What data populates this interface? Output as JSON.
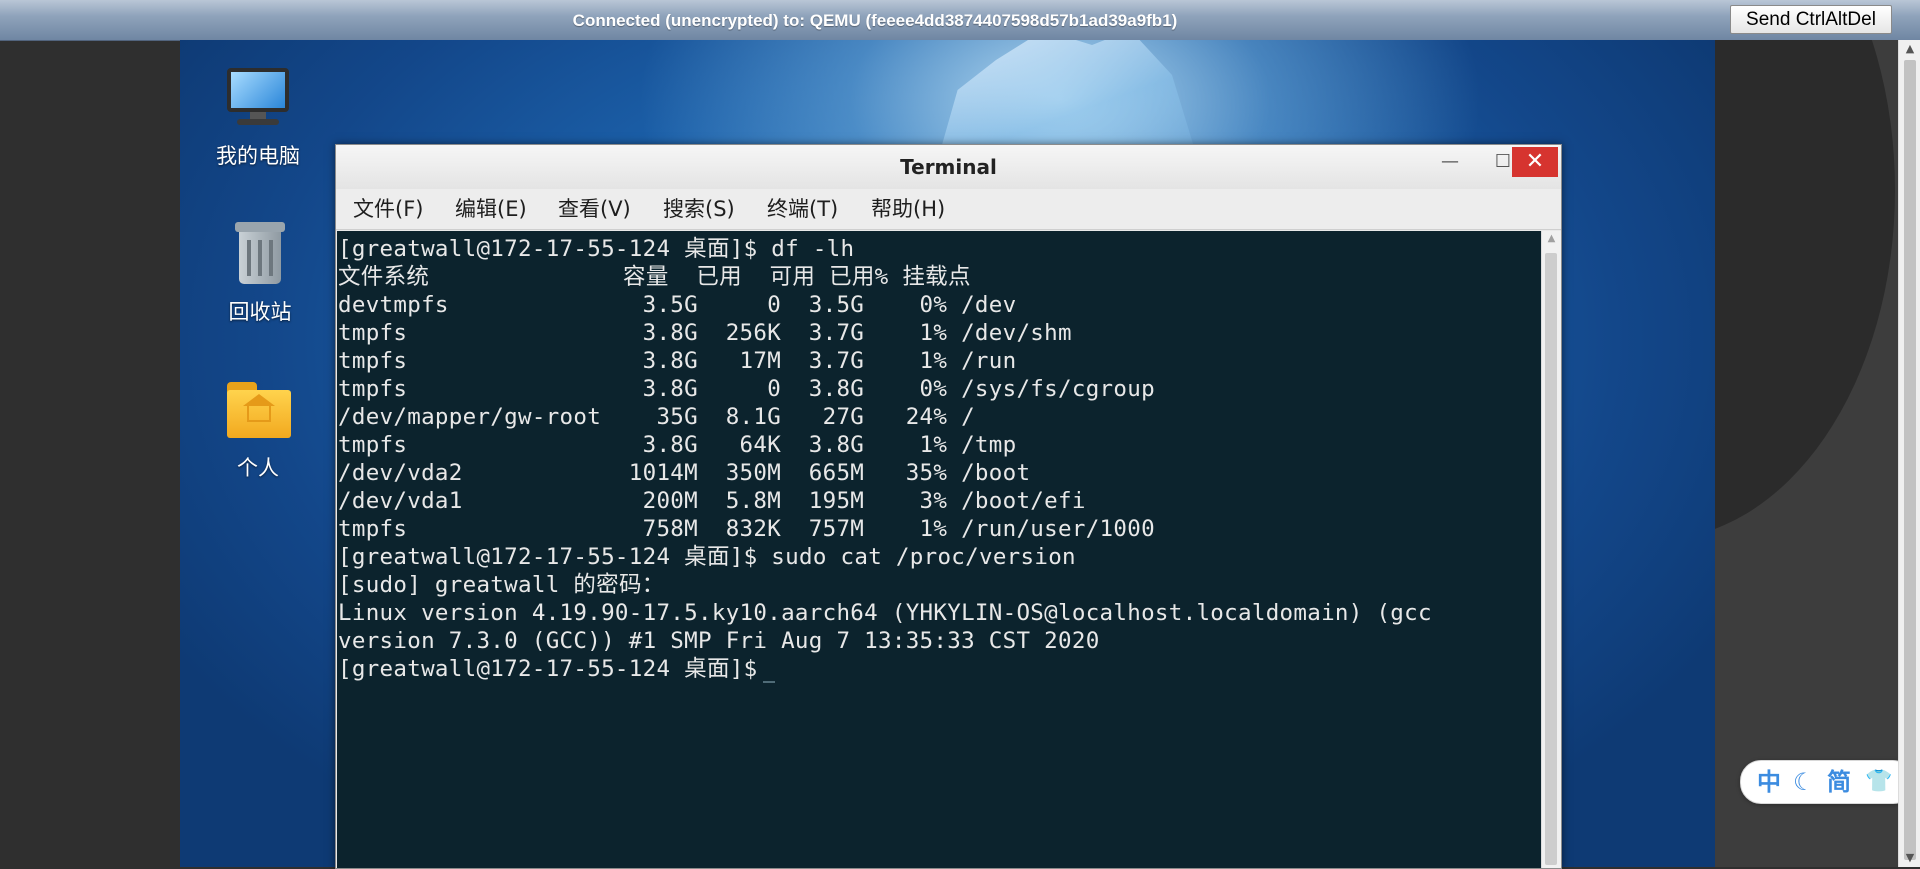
{
  "vnc": {
    "status": "Connected (unencrypted) to: QEMU (feeee4dd3874407598d57b1ad39a9fb1)",
    "send_cad_label": "Send CtrlAltDel"
  },
  "desktop": {
    "icons": [
      {
        "label": "我的电脑",
        "icon": "computer-icon"
      },
      {
        "label": "回收站",
        "icon": "trash-icon"
      },
      {
        "label": "个人",
        "icon": "home-folder-icon"
      }
    ]
  },
  "terminal": {
    "title": "Terminal",
    "controls": {
      "minimize": "—",
      "maximize": "☐",
      "close": "✕"
    },
    "menu": [
      "文件(F)",
      "编辑(E)",
      "查看(V)",
      "搜索(S)",
      "终端(T)",
      "帮助(H)"
    ],
    "lines": [
      "[greatwall@172-17-55-124 桌面]$ df -lh",
      "文件系统              容量  已用  可用 已用% 挂载点",
      "devtmpfs              3.5G     0  3.5G    0% /dev",
      "tmpfs                 3.8G  256K  3.7G    1% /dev/shm",
      "tmpfs                 3.8G   17M  3.7G    1% /run",
      "tmpfs                 3.8G     0  3.8G    0% /sys/fs/cgroup",
      "/dev/mapper/gw-root    35G  8.1G   27G   24% /",
      "tmpfs                 3.8G   64K  3.8G    1% /tmp",
      "/dev/vda2            1014M  350M  665M   35% /boot",
      "/dev/vda1             200M  5.8M  195M    3% /boot/efi",
      "tmpfs                 758M  832K  757M    1% /run/user/1000",
      "[greatwall@172-17-55-124 桌面]$ sudo cat /proc/version",
      "[sudo] greatwall 的密码：",
      "Linux version 4.19.90-17.5.ky10.aarch64 (YHKYLIN-OS@localhost.localdomain) (gcc",
      "version 7.3.0 (GCC)) #1 SMP Fri Aug 7 13:35:33 CST 2020",
      "[greatwall@172-17-55-124 桌面]$"
    ]
  },
  "ime": {
    "mode": "中",
    "moon": "☾",
    "script": "简",
    "skin": "👕"
  },
  "colors": {
    "terminal_bg": "#0c232d",
    "close_button": "#d6342f",
    "ime_accent": "#3c8ce0"
  }
}
